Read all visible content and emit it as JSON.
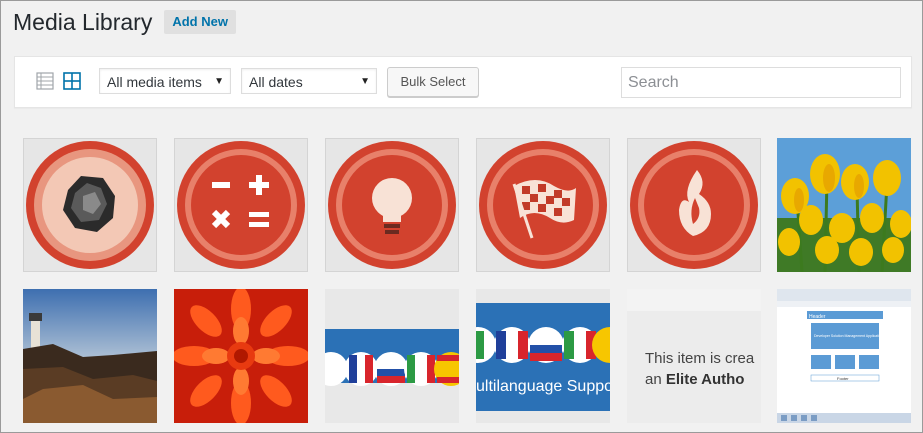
{
  "header": {
    "title": "Media Library",
    "add_new_label": "Add New"
  },
  "toolbar": {
    "view_list_icon": "list-view-icon",
    "view_grid_icon": "grid-view-icon",
    "media_filter": "All media items",
    "date_filter": "All dates",
    "bulk_select_label": "Bulk Select",
    "search_placeholder": "Search"
  },
  "colors": {
    "accent": "#0073aa",
    "badge_red": "#d2422e"
  },
  "media_items": [
    {
      "kind": "crumpled-paper-icon"
    },
    {
      "kind": "calculator-icon"
    },
    {
      "kind": "lightbulb-icon"
    },
    {
      "kind": "checkered-flag-icon"
    },
    {
      "kind": "flame-icon"
    },
    {
      "kind": "tulips-photo"
    },
    {
      "kind": "lighthouse-photo"
    },
    {
      "kind": "red-flower-photo"
    },
    {
      "kind": "flags-banner"
    },
    {
      "kind": "multilanguage-banner",
      "text": "ultilanguage Suppo"
    },
    {
      "kind": "elite-author-banner",
      "line1": "This item is crea",
      "line2_prefix": "an ",
      "line2_bold": "Elite Autho"
    },
    {
      "kind": "layout-screenshot",
      "title": "Header",
      "box1": "Developer Solution Management Application",
      "footer": "Footer"
    }
  ]
}
